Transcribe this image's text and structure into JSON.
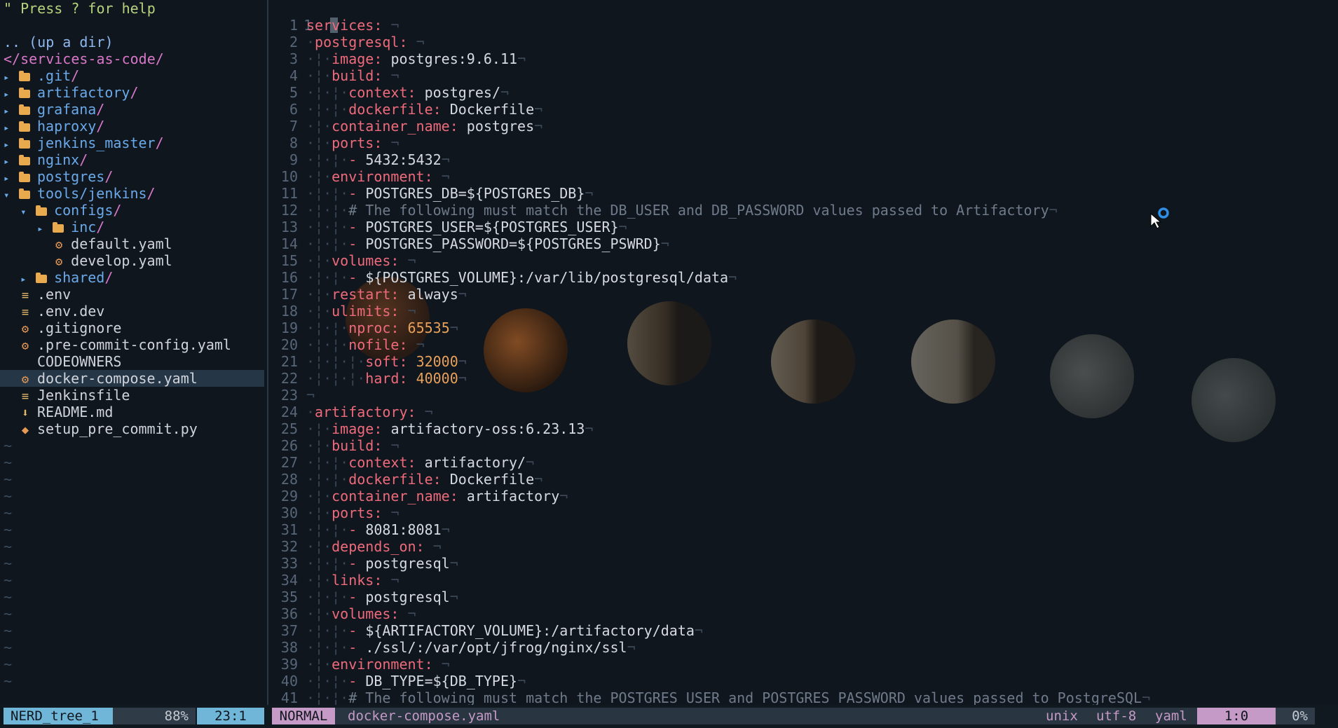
{
  "nerdtree": {
    "help": "\" Press ? for help",
    "up_dir": ".. (up a dir)",
    "root": "</services-as-code/",
    "entries": [
      {
        "kind": "dir",
        "depth": 0,
        "open": false,
        "name": ".git"
      },
      {
        "kind": "dir",
        "depth": 0,
        "open": false,
        "name": "artifactory"
      },
      {
        "kind": "dir",
        "depth": 0,
        "open": false,
        "name": "grafana"
      },
      {
        "kind": "dir",
        "depth": 0,
        "open": false,
        "name": "haproxy"
      },
      {
        "kind": "dir",
        "depth": 0,
        "open": false,
        "name": "jenkins_master"
      },
      {
        "kind": "dir",
        "depth": 0,
        "open": false,
        "name": "nginx"
      },
      {
        "kind": "dir",
        "depth": 0,
        "open": false,
        "name": "postgres"
      },
      {
        "kind": "dir",
        "depth": 0,
        "open": true,
        "name": "tools/jenkins"
      },
      {
        "kind": "dir",
        "depth": 1,
        "open": true,
        "name": "configs"
      },
      {
        "kind": "dir",
        "depth": 2,
        "open": false,
        "name": "inc"
      },
      {
        "kind": "file",
        "depth": 2,
        "icon": "gear-icon",
        "name": "default.yaml"
      },
      {
        "kind": "file",
        "depth": 2,
        "icon": "gear-icon",
        "name": "develop.yaml"
      },
      {
        "kind": "dir",
        "depth": 1,
        "open": false,
        "name": "shared"
      },
      {
        "kind": "file",
        "depth": 0,
        "icon": "lines-icon",
        "name": ".env"
      },
      {
        "kind": "file",
        "depth": 0,
        "icon": "lines-icon",
        "name": ".env.dev"
      },
      {
        "kind": "file",
        "depth": 0,
        "icon": "gear-icon",
        "name": ".gitignore"
      },
      {
        "kind": "file",
        "depth": 0,
        "icon": "gear-icon",
        "name": ".pre-commit-config.yaml"
      },
      {
        "kind": "file",
        "depth": 0,
        "icon": "none",
        "name": "CODEOWNERS"
      },
      {
        "kind": "file",
        "depth": 0,
        "icon": "gear-icon",
        "name": "docker-compose.yaml",
        "selected": true
      },
      {
        "kind": "file",
        "depth": 0,
        "icon": "lines-icon",
        "name": "Jenkinsfile"
      },
      {
        "kind": "file",
        "depth": 0,
        "icon": "download-icon",
        "name": "README.md"
      },
      {
        "kind": "file",
        "depth": 0,
        "icon": "python-icon",
        "name": "setup_pre_commit.py"
      }
    ],
    "empty_line_marker": "~"
  },
  "editor": {
    "top_line_number": "1",
    "lines": [
      {
        "n": "1",
        "indent": 0,
        "key": "services",
        "val": ""
      },
      {
        "n": "2",
        "indent": 1,
        "key": "postgresql",
        "val": ""
      },
      {
        "n": "3",
        "indent": 2,
        "key": "image",
        "val": "postgres:9.6.11"
      },
      {
        "n": "4",
        "indent": 2,
        "key": "build",
        "val": ""
      },
      {
        "n": "5",
        "indent": 3,
        "key": "context",
        "val": "postgres/"
      },
      {
        "n": "6",
        "indent": 3,
        "key": "dockerfile",
        "val": "Dockerfile"
      },
      {
        "n": "7",
        "indent": 2,
        "key": "container_name",
        "val": "postgres"
      },
      {
        "n": "8",
        "indent": 2,
        "key": "ports",
        "val": ""
      },
      {
        "n": "9",
        "indent": 3,
        "item": "5432:5432"
      },
      {
        "n": "10",
        "indent": 2,
        "key": "environment",
        "val": ""
      },
      {
        "n": "11",
        "indent": 3,
        "item": "POSTGRES_DB=${POSTGRES_DB}"
      },
      {
        "n": "12",
        "indent": 3,
        "comment": "# The following must match the DB_USER and DB_PASSWORD values passed to Artifactory"
      },
      {
        "n": "13",
        "indent": 3,
        "item": "POSTGRES_USER=${POSTGRES_USER}"
      },
      {
        "n": "14",
        "indent": 3,
        "item": "POSTGRES_PASSWORD=${POSTGRES_PSWRD}"
      },
      {
        "n": "15",
        "indent": 2,
        "key": "volumes",
        "val": ""
      },
      {
        "n": "16",
        "indent": 3,
        "item": "${POSTGRES_VOLUME}:/var/lib/postgresql/data"
      },
      {
        "n": "17",
        "indent": 2,
        "key": "restart",
        "val": "always"
      },
      {
        "n": "18",
        "indent": 2,
        "key": "ulimits",
        "val": ""
      },
      {
        "n": "19",
        "indent": 3,
        "key": "nproc",
        "num": "65535"
      },
      {
        "n": "20",
        "indent": 3,
        "key": "nofile",
        "val": ""
      },
      {
        "n": "21",
        "indent": 4,
        "key": "soft",
        "num": "32000"
      },
      {
        "n": "22",
        "indent": 4,
        "key": "hard",
        "num": "40000"
      },
      {
        "n": "23",
        "indent": 0,
        "blank": true
      },
      {
        "n": "24",
        "indent": 1,
        "key": "artifactory",
        "val": ""
      },
      {
        "n": "25",
        "indent": 2,
        "key": "image",
        "val": "artifactory-oss:6.23.13"
      },
      {
        "n": "26",
        "indent": 2,
        "key": "build",
        "val": ""
      },
      {
        "n": "27",
        "indent": 3,
        "key": "context",
        "val": "artifactory/"
      },
      {
        "n": "28",
        "indent": 3,
        "key": "dockerfile",
        "val": "Dockerfile"
      },
      {
        "n": "29",
        "indent": 2,
        "key": "container_name",
        "val": "artifactory"
      },
      {
        "n": "30",
        "indent": 2,
        "key": "ports",
        "val": ""
      },
      {
        "n": "31",
        "indent": 3,
        "item": "8081:8081"
      },
      {
        "n": "32",
        "indent": 2,
        "key": "depends_on",
        "val": ""
      },
      {
        "n": "33",
        "indent": 3,
        "item": "postgresql"
      },
      {
        "n": "34",
        "indent": 2,
        "key": "links",
        "val": ""
      },
      {
        "n": "35",
        "indent": 3,
        "item": "postgresql"
      },
      {
        "n": "36",
        "indent": 2,
        "key": "volumes",
        "val": ""
      },
      {
        "n": "37",
        "indent": 3,
        "item": "${ARTIFACTORY_VOLUME}:/artifactory/data"
      },
      {
        "n": "38",
        "indent": 3,
        "item": "./ssl/:/var/opt/jfrog/nginx/ssl"
      },
      {
        "n": "39",
        "indent": 2,
        "key": "environment",
        "val": ""
      },
      {
        "n": "40",
        "indent": 3,
        "item": "DB_TYPE=${DB_TYPE}"
      },
      {
        "n": "41",
        "indent": 3,
        "comment": "# The following must match the POSTGRES_USER and POSTGRES_PASSWORD values passed to PostgreSQL"
      }
    ]
  },
  "statusbar": {
    "tree_name": "NERD_tree_1",
    "tree_percent": "88%",
    "tree_pos": "23:1",
    "mode": "NORMAL",
    "filename": "docker-compose.yaml",
    "fileformat": "unix",
    "encoding": "utf-8",
    "filetype": "yaml",
    "position": "1:0",
    "percent": "0%"
  },
  "colors": {
    "background": "#0f161d",
    "key": "#ef6a7b",
    "number": "#e8a15b",
    "directory": "#6aa9ea",
    "folder_icon": "#e9a94d",
    "status_mode_bg": "#c59ac6",
    "status_tree_bg": "#6fb6d8"
  }
}
